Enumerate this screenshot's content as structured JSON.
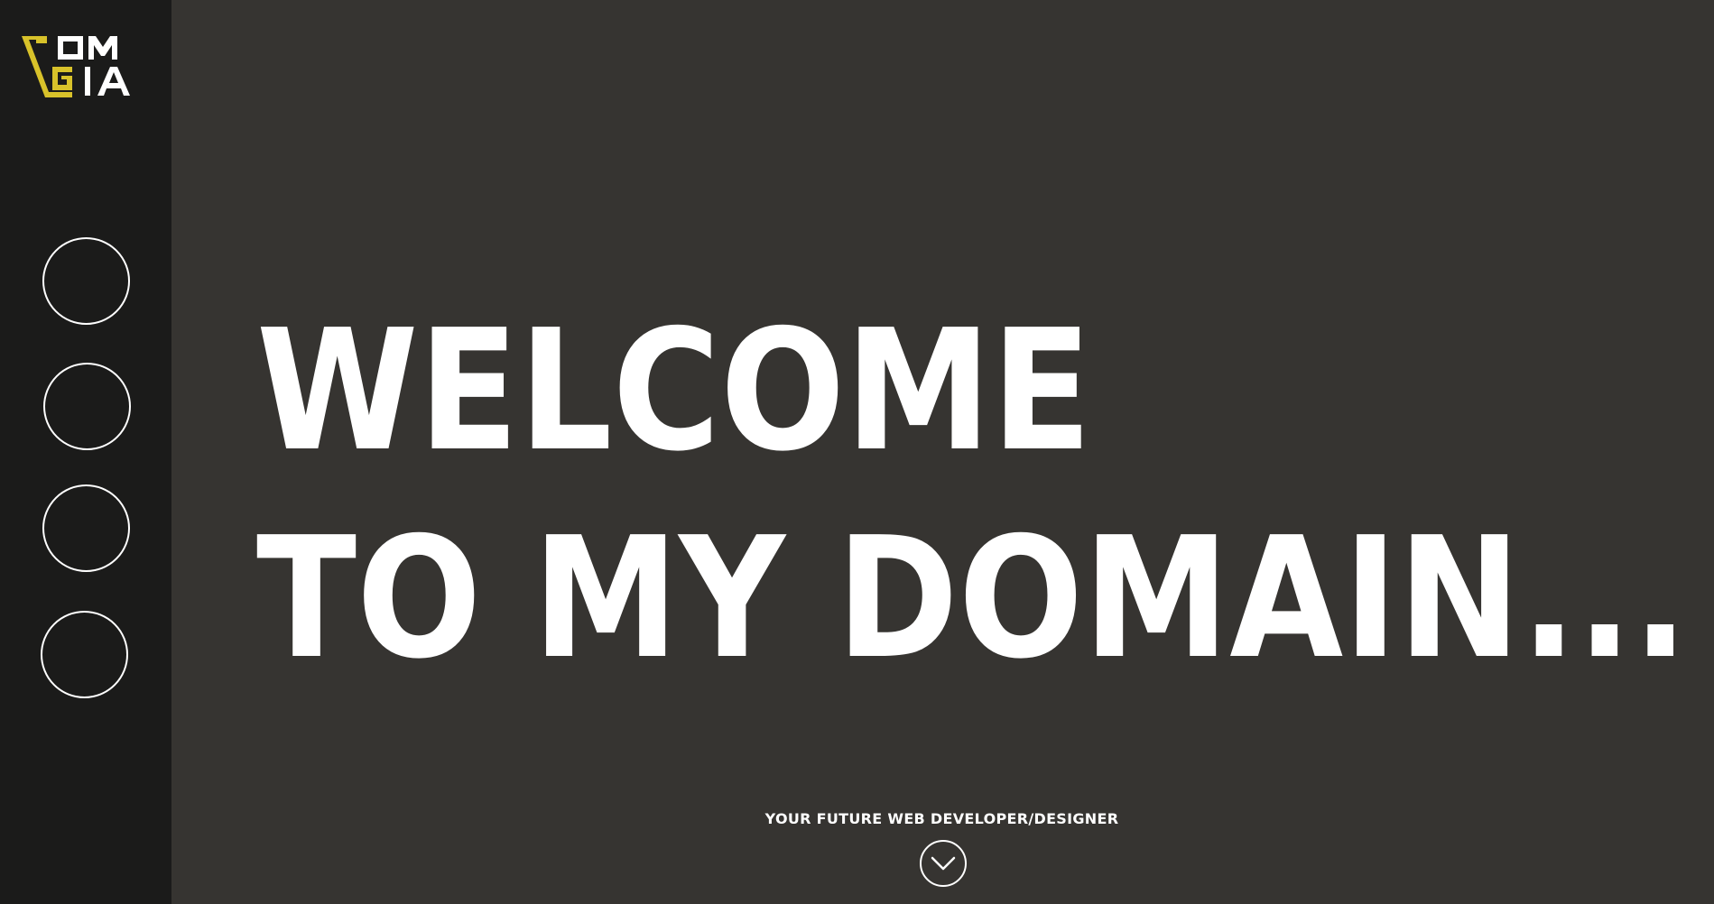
{
  "brand": {
    "logo_letters": "TOMGIA",
    "accent_color": "#d8c22a",
    "logo_icon": "tomgia-logo"
  },
  "sidebar": {
    "nav_items": [
      {
        "icon": "nav-circle"
      },
      {
        "icon": "nav-circle"
      },
      {
        "icon": "nav-circle"
      },
      {
        "icon": "nav-circle"
      }
    ]
  },
  "hero": {
    "line1": "WELCOME",
    "line2": "TO MY DOMAIN...",
    "tagline": "YOUR FUTURE WEB DEVELOPER/DESIGNER",
    "scroll_icon": "chevron-down-icon"
  },
  "colors": {
    "main_background": "#363431",
    "sidebar_background": "#1b1b1a",
    "text": "#ffffff"
  }
}
